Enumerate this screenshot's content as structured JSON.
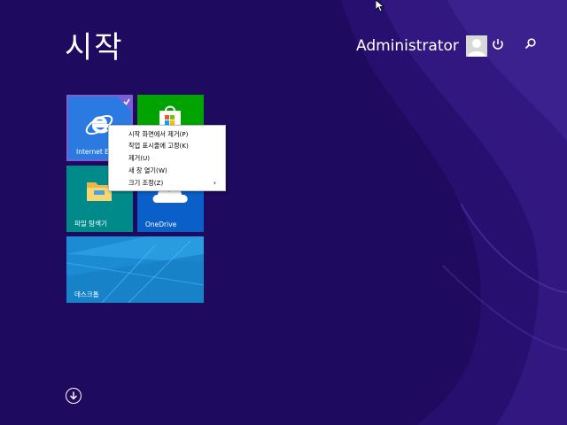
{
  "start": {
    "title": "시작"
  },
  "user": {
    "name": "Administrator"
  },
  "icons": {
    "power": "power-icon",
    "search": "search-icon",
    "all_apps": "arrow-down-circle-icon",
    "user": "user-avatar-icon"
  },
  "tiles": {
    "internet_explorer": {
      "label": "Internet Explorer",
      "color": "#2a7ae2",
      "selected": true
    },
    "store": {
      "label": "",
      "color": "#00a300"
    },
    "file_explorer": {
      "label": "파일 탐색기",
      "color": "#008a8a"
    },
    "onedrive": {
      "label": "OneDrive",
      "color": "#0a5fc8"
    },
    "desktop": {
      "label": "데스크톱",
      "color": "#1b8bd4"
    }
  },
  "context_menu": {
    "items": [
      {
        "label": "시작 화면에서 제거(P)"
      },
      {
        "label": "작업 표시줄에 고정(K)"
      },
      {
        "label": "제거(U)"
      },
      {
        "label": "새 창 열기(W)"
      },
      {
        "label": "크기 조정(Z)",
        "submenu_arrow": "›"
      }
    ]
  },
  "colors": {
    "background": "#1e0a5e",
    "selected_border": "#7b5fd6"
  }
}
